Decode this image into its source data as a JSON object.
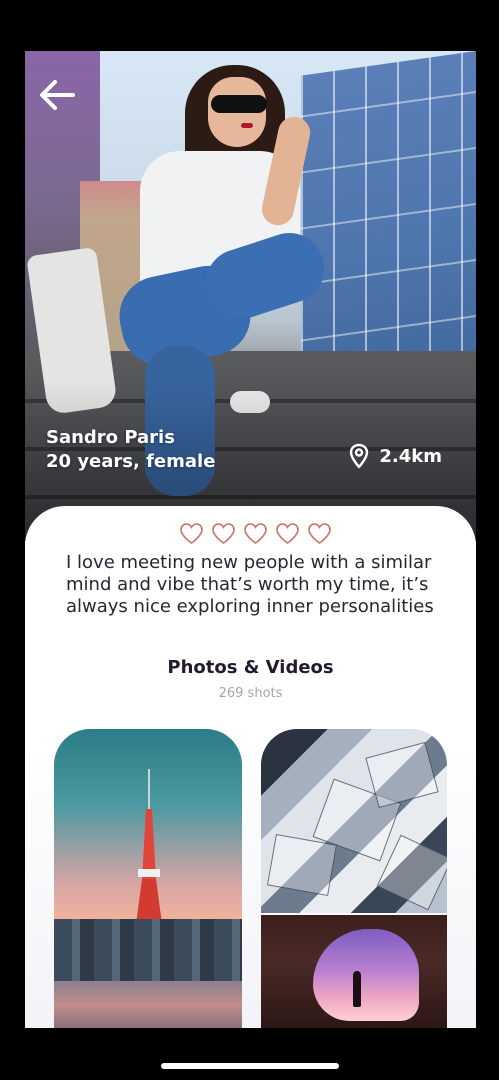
{
  "profile": {
    "name": "Sandro Paris",
    "meta": "20 years, female",
    "distance": "2.4km",
    "rating": 0,
    "rating_max": 5,
    "bio": "I love meeting new people with a similar mind and vibe that’s worth my time, it’s always nice exploring inner personalities"
  },
  "media": {
    "title": "Photos & Videos",
    "count": "269 shots"
  },
  "icons": {
    "back": "arrow-left-icon",
    "location": "location-pin-icon",
    "heart": "heart-outline-icon"
  },
  "colors": {
    "heart_stroke": "#c7735f",
    "title_text": "#241a2f",
    "body_text": "#2b2435",
    "muted_text": "#a7a3ab"
  }
}
